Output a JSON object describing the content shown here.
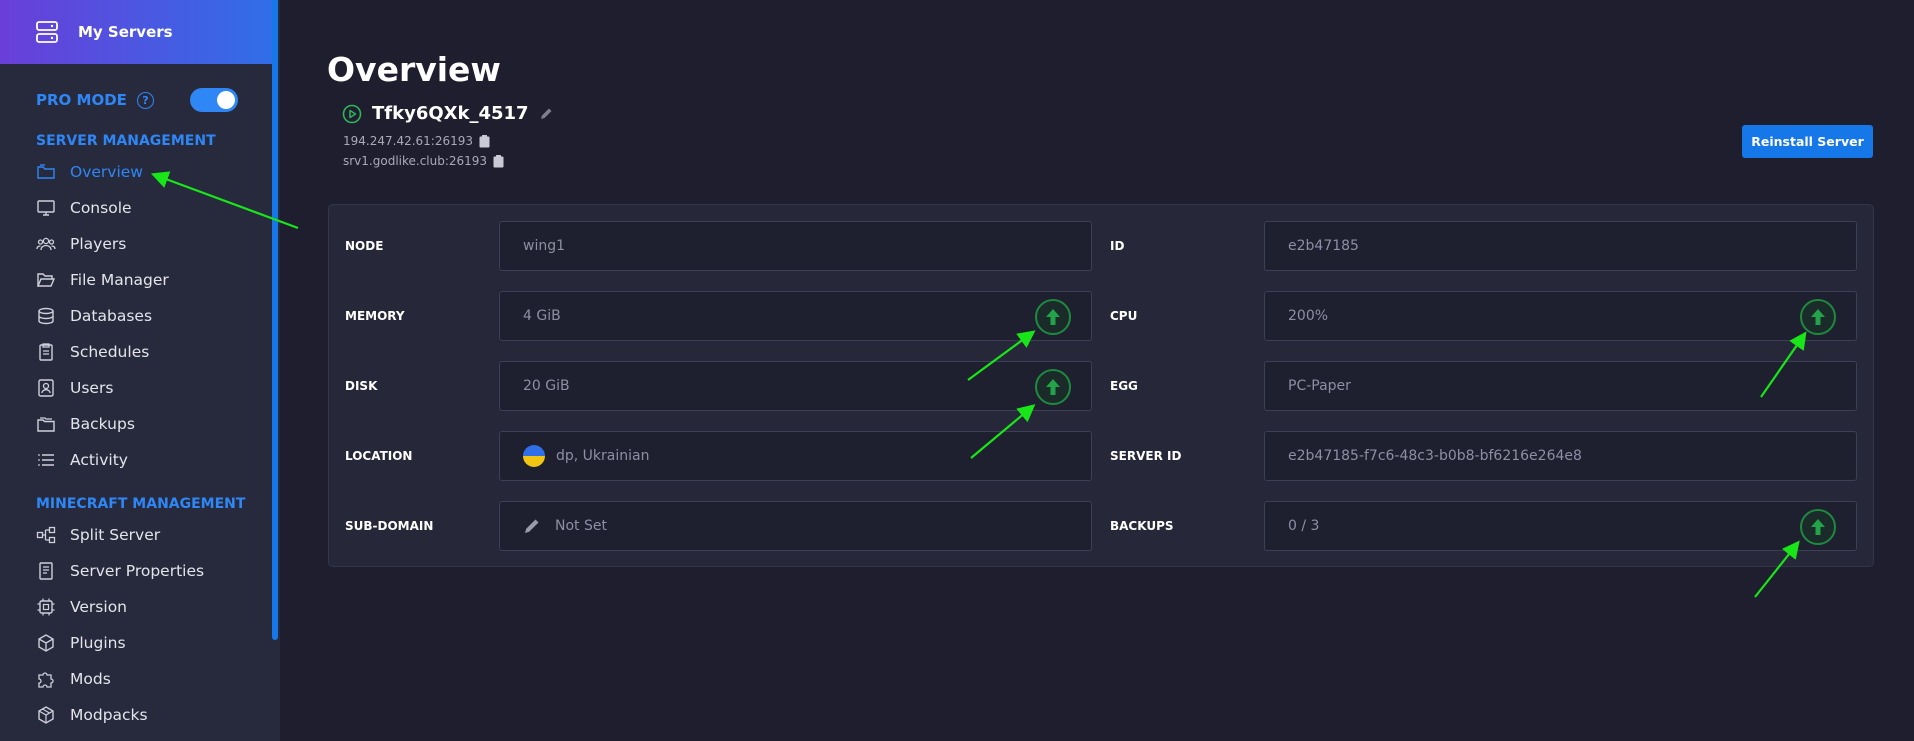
{
  "sidebar": {
    "brand_label": "My Servers",
    "pro_mode_label": "PRO MODE",
    "pro_mode_help": "?",
    "pro_mode_enabled": true,
    "server_management_title": "SERVER MANAGEMENT",
    "server_items": [
      {
        "label": "Overview",
        "icon": "folder-icon",
        "active": true
      },
      {
        "label": "Console",
        "icon": "console-icon",
        "active": false
      },
      {
        "label": "Players",
        "icon": "players-icon",
        "active": false
      },
      {
        "label": "File Manager",
        "icon": "folder-open-icon",
        "active": false
      },
      {
        "label": "Databases",
        "icon": "database-icon",
        "active": false
      },
      {
        "label": "Schedules",
        "icon": "clipboard-icon",
        "active": false
      },
      {
        "label": "Users",
        "icon": "user-badge-icon",
        "active": false
      },
      {
        "label": "Backups",
        "icon": "backups-icon",
        "active": false
      },
      {
        "label": "Activity",
        "icon": "list-icon",
        "active": false
      }
    ],
    "minecraft_management_title": "MINECRAFT MANAGEMENT",
    "minecraft_items": [
      {
        "label": "Split Server",
        "icon": "split-icon"
      },
      {
        "label": "Server Properties",
        "icon": "document-icon"
      },
      {
        "label": "Version",
        "icon": "chip-icon"
      },
      {
        "label": "Plugins",
        "icon": "cube-icon"
      },
      {
        "label": "Mods",
        "icon": "puzzle-icon"
      },
      {
        "label": "Modpacks",
        "icon": "box-icon"
      }
    ]
  },
  "main": {
    "title": "Overview",
    "server_name": "Tfky6QXk_4517",
    "address_ip": "194.247.42.61:26193",
    "address_domain": "srv1.godlike.club:26193",
    "reinstall_label": "Reinstall Server",
    "fields": {
      "node": {
        "label": "NODE",
        "value": "wing1"
      },
      "memory": {
        "label": "MEMORY",
        "value": "4 GiB"
      },
      "disk": {
        "label": "DISK",
        "value": "20 GiB"
      },
      "location": {
        "label": "LOCATION",
        "value": "dp, Ukrainian"
      },
      "subdomain": {
        "label": "SUB-DOMAIN",
        "value": "Not Set"
      },
      "id": {
        "label": "ID",
        "value": "e2b47185"
      },
      "cpu": {
        "label": "CPU",
        "value": "200%"
      },
      "egg": {
        "label": "EGG",
        "value": "PC-Paper"
      },
      "server_id": {
        "label": "SERVER ID",
        "value": "e2b47185-f7c6-48c3-b0b8-bf6216e264e8"
      },
      "backups": {
        "label": "BACKUPS",
        "value": "0 / 3"
      }
    }
  },
  "colors": {
    "accent": "#2f86f5",
    "upgrade": "#1e8a3e",
    "annotation_arrow": "#19e619"
  }
}
